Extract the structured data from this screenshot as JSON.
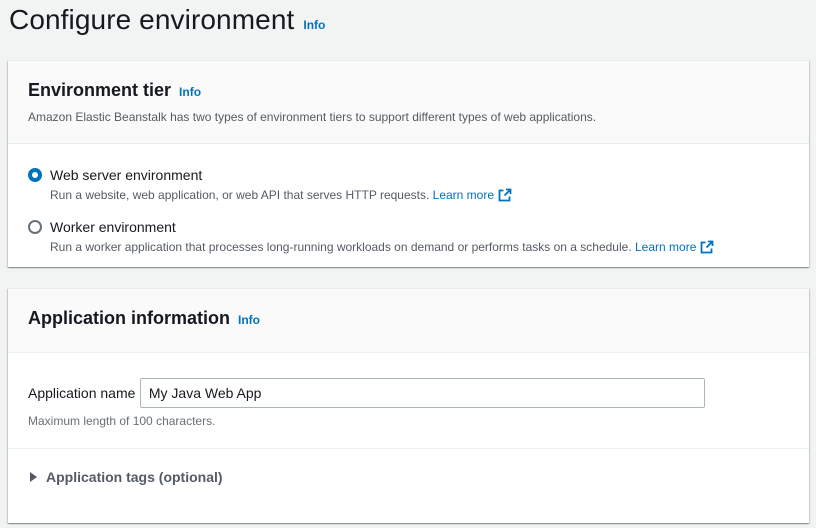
{
  "page": {
    "title": "Configure environment",
    "info": "Info"
  },
  "tier": {
    "title": "Environment tier",
    "info": "Info",
    "description": "Amazon Elastic Beanstalk has two types of environment tiers to support different types of web applications.",
    "options": [
      {
        "label": "Web server environment",
        "description": "Run a website, web application, or web API that serves HTTP requests.",
        "learn_more": "Learn more",
        "selected": true
      },
      {
        "label": "Worker environment",
        "description": "Run a worker application that processes long-running workloads on demand or performs tasks on a schedule.",
        "learn_more": "Learn more",
        "selected": false
      }
    ]
  },
  "app": {
    "title": "Application information",
    "info": "Info",
    "name_label": "Application name",
    "name_value": "My Java Web App",
    "name_hint": "Maximum length of 100 characters.",
    "tags_label": "Application tags (optional)"
  },
  "colors": {
    "accent": "#0073bb",
    "background": "#f2f3f3",
    "text_secondary": "#545b64"
  },
  "icons": {
    "external": "external-link-icon",
    "caret": "caret-right-icon"
  }
}
